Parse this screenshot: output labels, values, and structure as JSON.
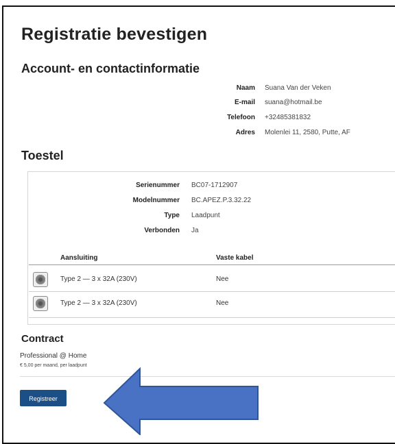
{
  "title": "Registratie bevestigen",
  "account": {
    "heading": "Account- en contactinformatie",
    "fields": [
      {
        "label": "Naam",
        "value": "Suana Van der Veken"
      },
      {
        "label": "E-mail",
        "value": "suana@hotmail.be"
      },
      {
        "label": "Telefoon",
        "value": "+32485381832"
      },
      {
        "label": "Adres",
        "value": "Molenlei 11, 2580, Putte, AF"
      }
    ]
  },
  "device": {
    "heading": "Toestel",
    "fields": [
      {
        "label": "Serienummer",
        "value": "BC07-1712907"
      },
      {
        "label": "Modelnummer",
        "value": "BC.APEZ.P.3.32.22"
      },
      {
        "label": "Type",
        "value": "Laadpunt"
      },
      {
        "label": "Verbonden",
        "value": "Ja"
      }
    ],
    "columns": [
      "Aansluiting",
      "Vaste kabel"
    ],
    "connections": [
      {
        "connector": "Type 2 — 3 x 32A (230V)",
        "fixed_cable": "Nee",
        "icon": "type2-plug-icon"
      },
      {
        "connector": "Type 2 — 3 x 32A (230V)",
        "fixed_cable": "Nee",
        "icon": "type2-plug-icon"
      }
    ]
  },
  "contract": {
    "heading": "Contract",
    "name": "Professional @ Home",
    "price": "€ 5,00 per maand, per laadpunt"
  },
  "register_button": "Registreer",
  "colors": {
    "button": "#1b4f86",
    "arrow_fill": "#4a72c4",
    "arrow_stroke": "#2f5597"
  }
}
